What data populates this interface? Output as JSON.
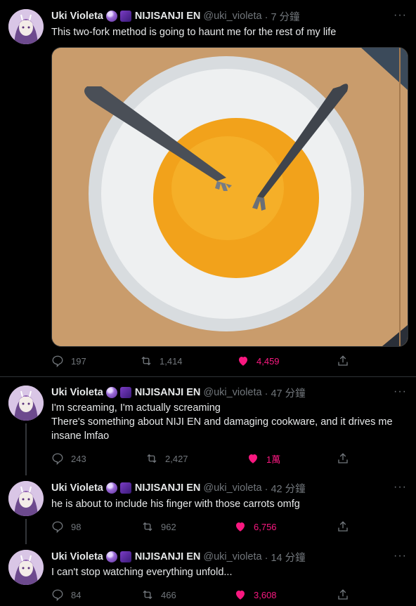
{
  "author": {
    "name": "Uki Violeta",
    "org": "NIJISANJI EN",
    "handle": "@uki_violeta",
    "badges": [
      "crystal-ball-emoji",
      "purple-square-emoji"
    ]
  },
  "tweets": [
    {
      "time": "· 7 分鐘",
      "text": "This two-fork method is going to haunt me for the rest of my life",
      "replies": "197",
      "retweets": "1,414",
      "likes": "4,459"
    },
    {
      "time": "· 47 分鐘",
      "text1": "I'm screaming, I'm actually screaming",
      "text2": "There's something about NIJI EN and damaging cookware, and it drives me insane lmfao",
      "replies": "243",
      "retweets": "2,427",
      "likes": "1萬"
    },
    {
      "time": "· 42 分鐘",
      "text": "he is about to include his finger with those carrots omfg",
      "replies": "98",
      "retweets": "962",
      "likes": "6,756"
    },
    {
      "time": "· 14 分鐘",
      "text": "I can't stop watching everything unfold...",
      "replies": "84",
      "retweets": "466",
      "likes": "3,608"
    }
  ],
  "colors": {
    "like": "#f91880",
    "muted": "#71767b",
    "background": "#000000",
    "text": "#e7e9ea"
  },
  "icons": [
    "reply-icon",
    "retweet-icon",
    "heart-icon",
    "share-icon",
    "more-icon"
  ]
}
